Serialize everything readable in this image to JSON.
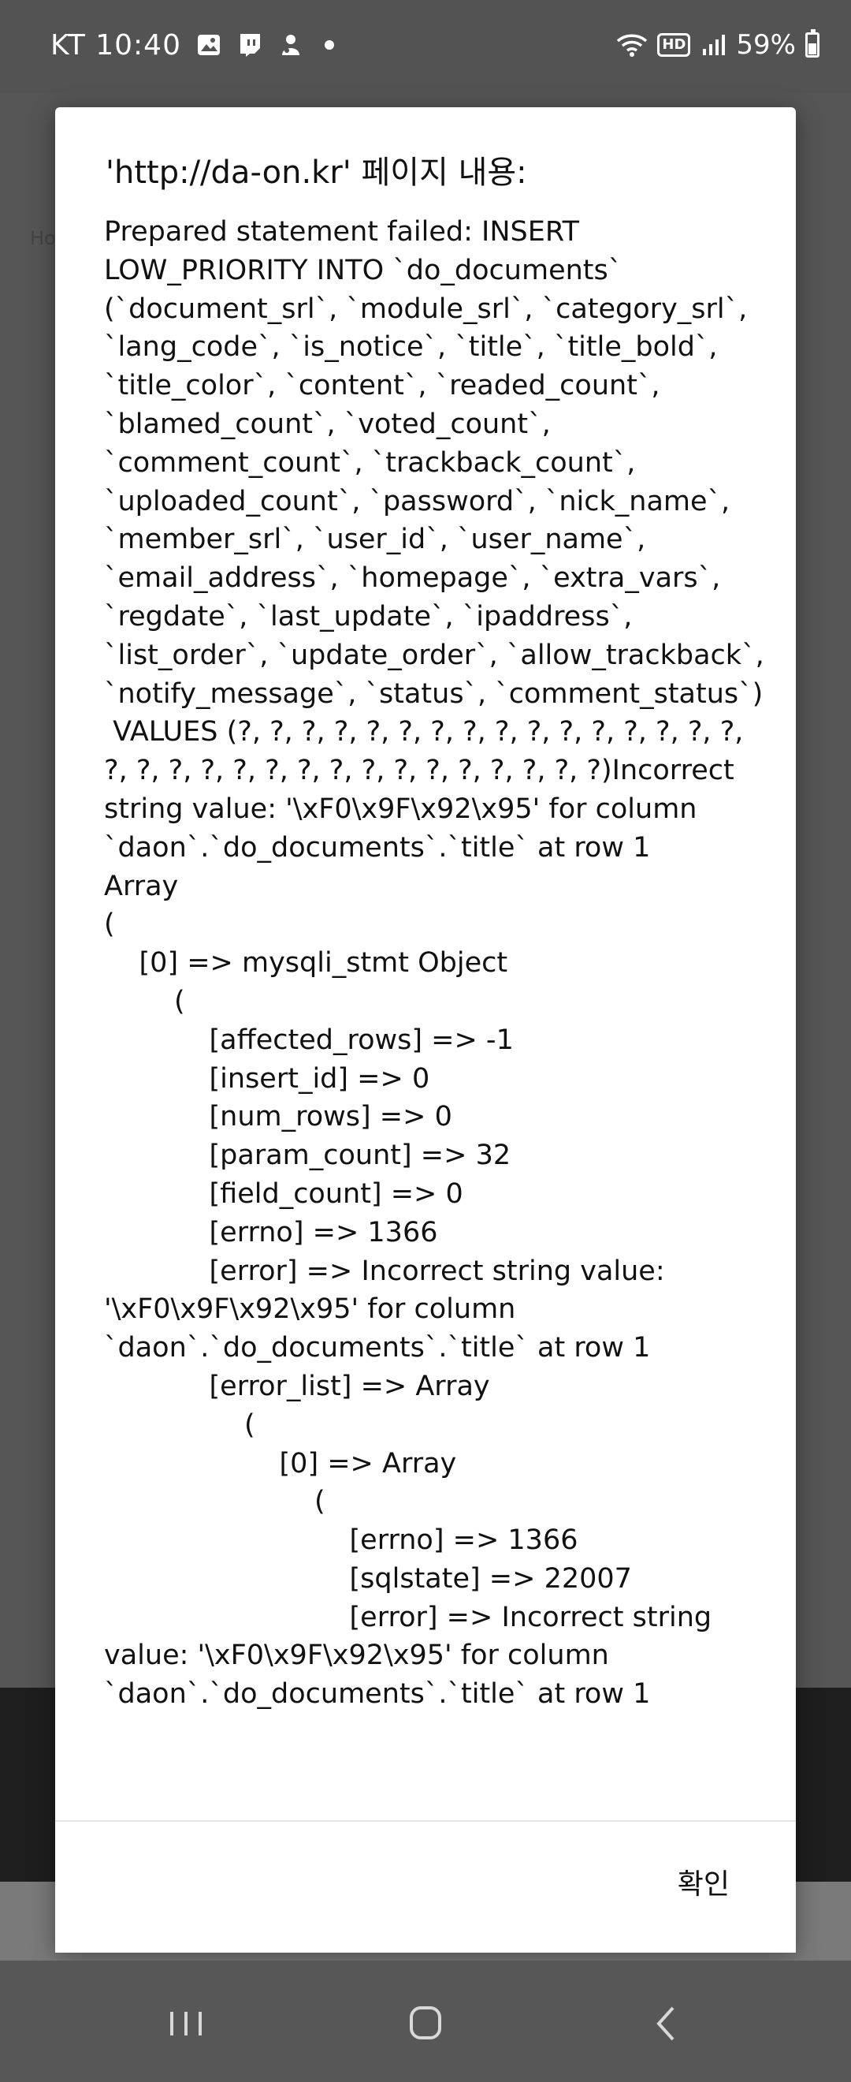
{
  "status_bar": {
    "carrier_time": "KT 10:40",
    "battery": "59%",
    "icons": [
      "gallery-icon",
      "twitch-icon",
      "app-icon",
      "dot-icon",
      "wifi-icon",
      "hd-icon",
      "signal-icon",
      "battery-icon"
    ],
    "hd_label": "HD"
  },
  "dialog": {
    "title": "'http://da-on.kr' 페이지 내용:",
    "message": "Prepared statement failed: INSERT LOW_PRIORITY INTO `do_documents` (`document_srl`, `module_srl`, `category_srl`, `lang_code`, `is_notice`, `title`, `title_bold`, `title_color`, `content`, `readed_count`, `blamed_count`, `voted_count`, `comment_count`, `trackback_count`, `uploaded_count`, `password`, `nick_name`, `member_srl`, `user_id`, `user_name`, `email_address`, `homepage`, `extra_vars`, `regdate`, `last_update`, `ipaddress`, `list_order`, `update_order`, `allow_trackback`, `notify_message`, `status`, `comment_status`)\n VALUES (?, ?, ?, ?, ?, ?, ?, ?, ?, ?, ?, ?, ?, ?, ?, ?, ?, ?, ?, ?, ?, ?, ?, ?, ?, ?, ?, ?, ?, ?, ?, ?)Incorrect string value: '\\xF0\\x9F\\x92\\x95' for column `daon`.`do_documents`.`title` at row 1\nArray\n(\n    [0] => mysqli_stmt Object\n        (\n            [affected_rows] => -1\n            [insert_id] => 0\n            [num_rows] => 0\n            [param_count] => 32\n            [field_count] => 0\n            [errno] => 1366\n            [error] => Incorrect string value: '\\xF0\\x9F\\x92\\x95' for column `daon`.`do_documents`.`title` at row 1\n            [error_list] => Array\n                (\n                    [0] => Array\n                        (\n                            [errno] => 1366\n                            [sqlstate] => 22007\n                            [error] => Incorrect string value: '\\xF0\\x9F\\x92\\x95' for column `daon`.`do_documents`.`title` at row 1",
    "ok_label": "확인"
  },
  "background": {
    "fragment_home": "Ho"
  },
  "nav_bar": {
    "icons": [
      "recent-apps-icon",
      "home-icon",
      "back-icon"
    ]
  }
}
